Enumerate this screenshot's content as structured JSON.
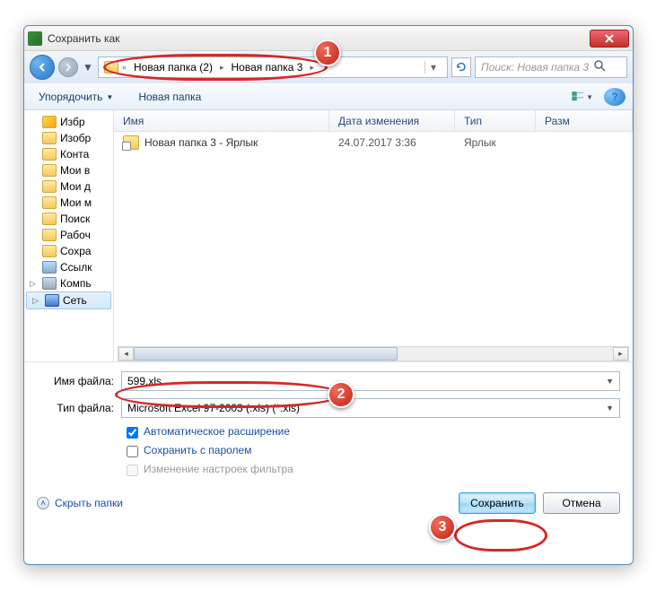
{
  "window": {
    "title": "Сохранить как"
  },
  "nav": {
    "crumbs": [
      "Новая папка (2)",
      "Новая папка 3"
    ],
    "search_placeholder": "Поиск: Новая папка 3"
  },
  "toolbar": {
    "organize": "Упорядочить",
    "new_folder": "Новая папка"
  },
  "sidebar": {
    "items": [
      "Избр",
      "Изобр",
      "Конта",
      "Мои в",
      "Мои д",
      "Мои м",
      "Поиск",
      "Рабоч",
      "Сохра",
      "Ссылк"
    ],
    "computer": "Компь",
    "network": "Сеть"
  },
  "columns": {
    "name": "Имя",
    "date": "Дата изменения",
    "type": "Тип",
    "size": "Разм"
  },
  "files": [
    {
      "name": "Новая папка 3 - Ярлык",
      "date": "24.07.2017 3:36",
      "type": "Ярлык"
    }
  ],
  "form": {
    "filename_label": "Имя файла:",
    "filename_value": "599.xls",
    "filetype_label": "Тип файла:",
    "filetype_value": "Microsoft Excel 97-2003 (.xls) (*.xls)",
    "auto_ext": "Автоматическое расширение",
    "save_pwd": "Сохранить с паролем",
    "filter_settings": "Изменение настроек фильтра"
  },
  "footer": {
    "hide_folders": "Скрыть папки",
    "save": "Сохранить",
    "cancel": "Отмена"
  },
  "callouts": {
    "c1": "1",
    "c2": "2",
    "c3": "3"
  }
}
